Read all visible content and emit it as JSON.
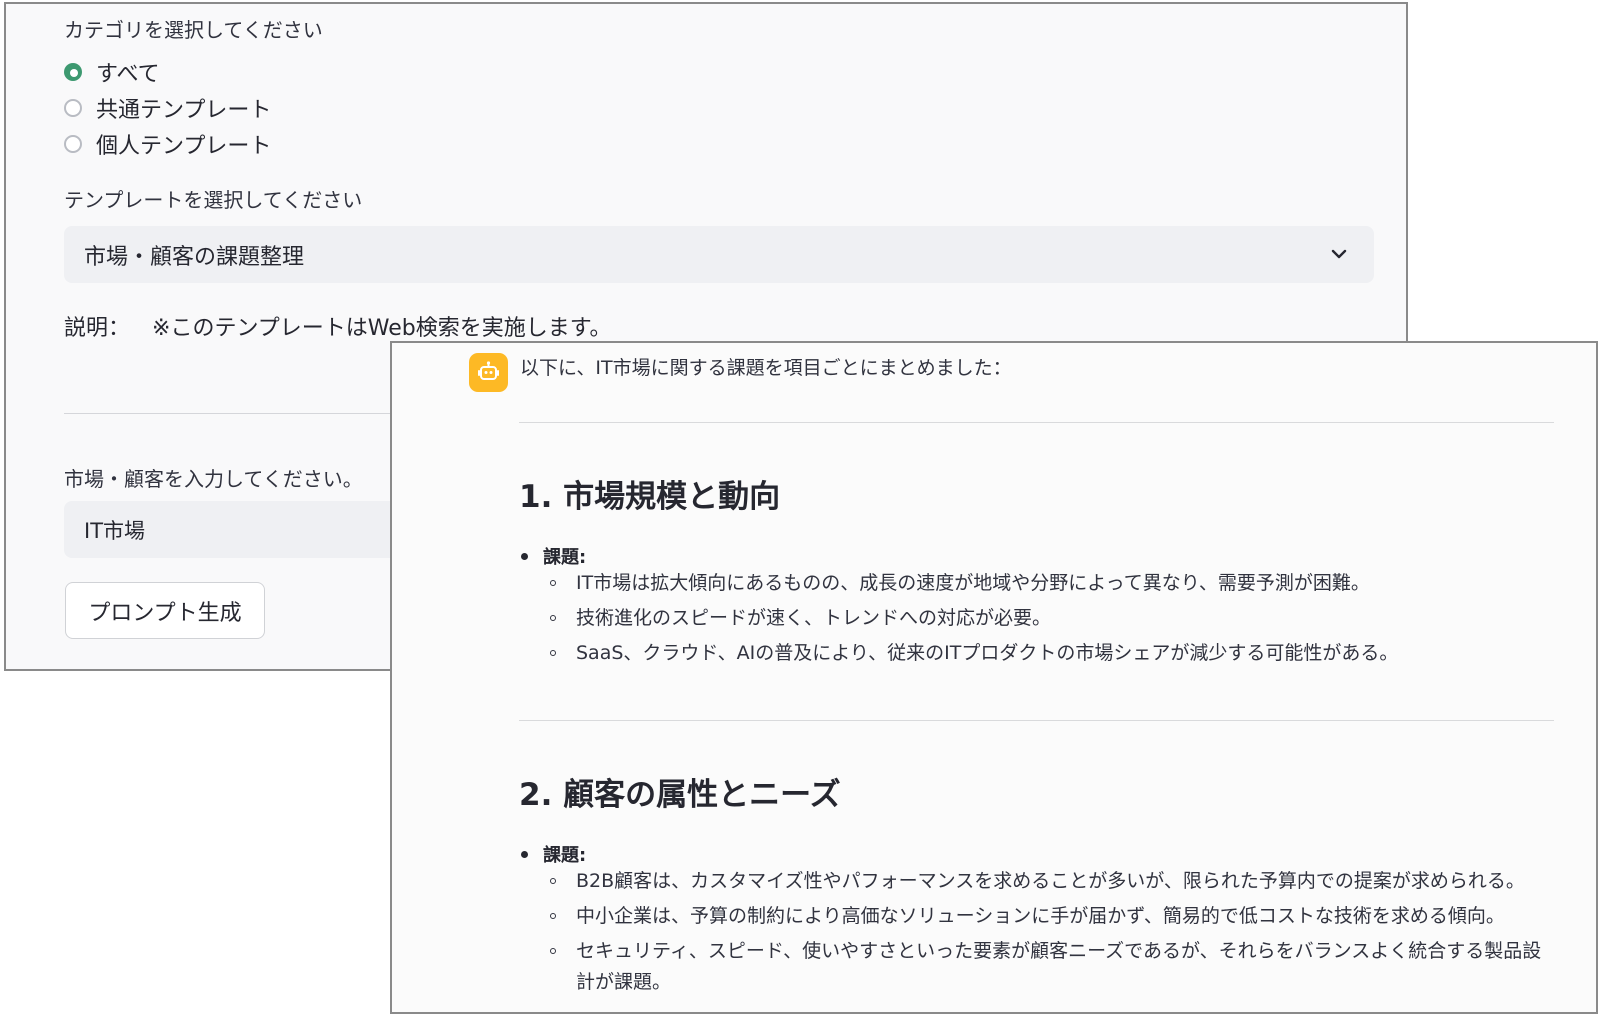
{
  "form": {
    "category_label": "カテゴリを選択してください",
    "categories": [
      {
        "label": "すべて",
        "selected": true
      },
      {
        "label": "共通テンプレート",
        "selected": false
      },
      {
        "label": "個人テンプレート",
        "selected": false
      }
    ],
    "template_label": "テンプレートを選択してください",
    "template_value": "市場・顧客の課題整理",
    "description_key": "説明：",
    "description_text": "※このテンプレートはWeb検索を実施します。",
    "market_label": "市場・顧客を入力してください。",
    "market_value": "IT市場",
    "generate_button": "プロンプト生成"
  },
  "response": {
    "avatar_icon": "robot-icon",
    "accent_color": "#fdb925",
    "intro": "以下に、IT市場に関する課題を項目ごとにまとめました：",
    "sections": [
      {
        "heading": "1. 市場規模と動向",
        "bullet": "課題:",
        "items": [
          "IT市場は拡大傾向にあるものの、成長の速度が地域や分野によって異なり、需要予測が困難。",
          "技術進化のスピードが速く、トレンドへの対応が必要。",
          "SaaS、クラウド、AIの普及により、従来のITプロダクトの市場シェアが減少する可能性がある。"
        ]
      },
      {
        "heading": "2. 顧客の属性とニーズ",
        "bullet": "課題:",
        "items": [
          "B2B顧客は、カスタマイズ性やパフォーマンスを求めることが多いが、限られた予算内での提案が求められる。",
          "中小企業は、予算の制約により高価なソリューションに手が届かず、簡易的で低コストな技術を求める傾向。",
          "セキュリティ、スピード、使いやすさといった要素が顧客ニーズであるが、それらをバランスよく統合する製品設計が課題。"
        ]
      }
    ]
  }
}
